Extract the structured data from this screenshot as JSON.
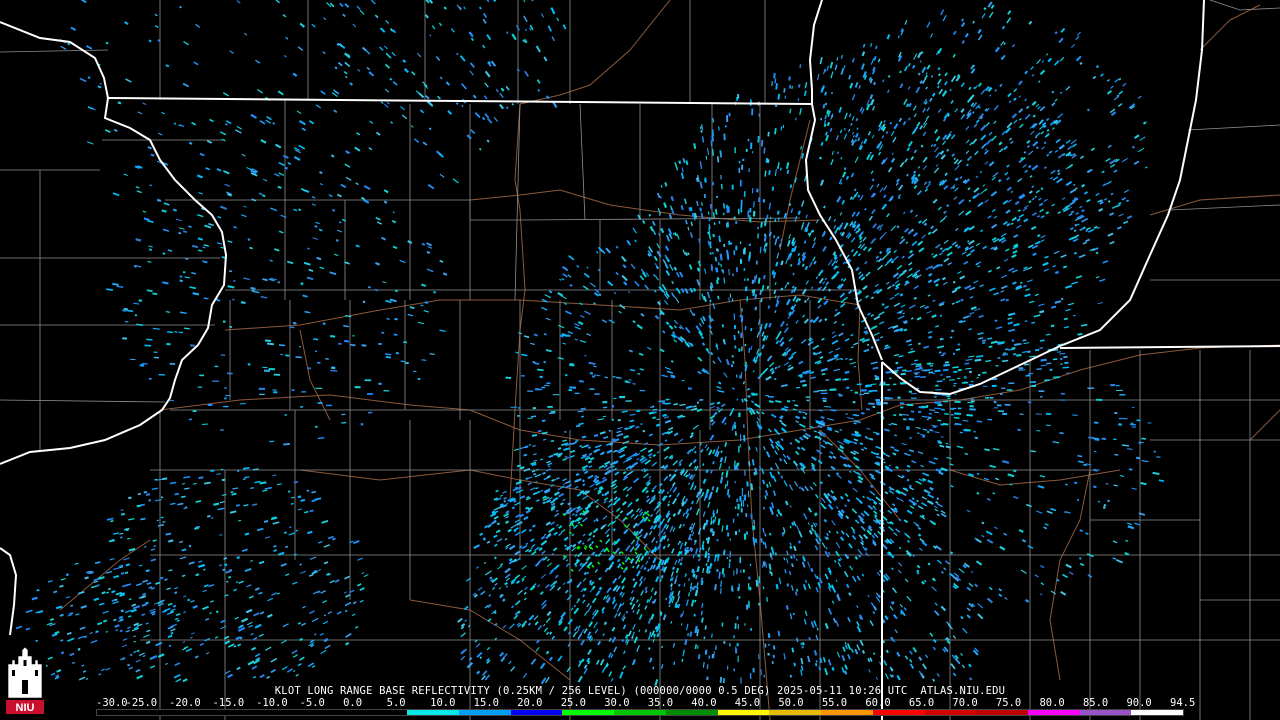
{
  "header": {
    "product_line": "KLOT LONG RANGE BASE REFLECTIVITY (0.25KM / 256 LEVEL) (000000/0000 0.5 DEG) 2025-05-11 10:26 UTC  ATLAS.NIU.EDU"
  },
  "logo": {
    "text": "NIU",
    "icon": "niu-castle-logo-icon"
  },
  "legend": {
    "labels": [
      "-30.0",
      "-25.0",
      "-20.0",
      "-15.0",
      "-10.0",
      "-5.0",
      "0.0",
      "5.0",
      "10.0",
      "15.0",
      "20.0",
      "25.0",
      "30.0",
      "35.0",
      "40.0",
      "45.0",
      "50.0",
      "55.0",
      "60.0",
      "65.0",
      "70.0",
      "75.0",
      "80.0",
      "85.0",
      "90.0",
      "94.5"
    ],
    "colors": [
      "#000000",
      "#000000",
      "#000000",
      "#000000",
      "#000000",
      "#000000",
      "#04e9e7",
      "#019ff4",
      "#0300f4",
      "#02fd02",
      "#01c501",
      "#008e00",
      "#fdf802",
      "#e5bc00",
      "#fd9500",
      "#fd0000",
      "#d40000",
      "#bc0000",
      "#f800fd",
      "#9854c6",
      "#fdfdfd"
    ]
  },
  "radar": {
    "site": "KLOT",
    "echo_colors": [
      "#1e90ff",
      "#00bfff",
      "#19d3e0",
      "#38a0f0",
      "#2a7fe0",
      "#0ad1d1",
      "#1aa8ff",
      "#3ec8e8"
    ]
  },
  "map": {
    "state_line_color": "#ffffff",
    "county_line_color": "#9a9a9a",
    "road_color": "#8b5a3c"
  }
}
